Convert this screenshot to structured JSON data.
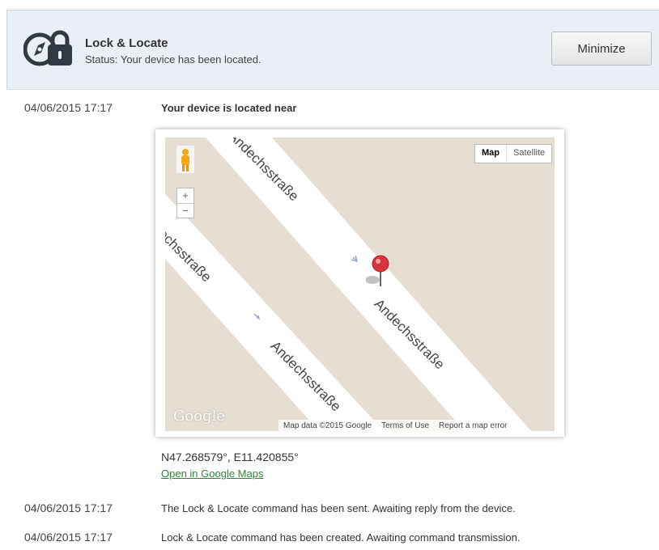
{
  "header": {
    "title": "Lock & Locate",
    "status": "Status: Your device has been located.",
    "minimize_label": "Minimize"
  },
  "log": [
    {
      "timestamp": "04/06/2015 17:17",
      "message": "Your device is located near"
    },
    {
      "timestamp": "04/06/2015 17:17",
      "message": "The Lock & Locate command has been sent. Awaiting reply from the device."
    },
    {
      "timestamp": "04/06/2015 17:17",
      "message": "Lock & Locate command has been created. Awaiting command transmission."
    }
  ],
  "map": {
    "type_map": "Map",
    "type_satellite": "Satellite",
    "zoom_in": "+",
    "zoom_out": "−",
    "street_name": "Andechsstraße",
    "street_label_1": "Andechsstraße",
    "street_label_2": "Andechsstraße",
    "street_label_3": "Andechsstraße",
    "street_label_4": "Andechsstraße",
    "logo": "Google",
    "attribution_data": "Map data ©2015 Google",
    "attribution_terms": "Terms of Use",
    "attribution_report": "Report a map error",
    "road_color": "#ffffff",
    "land_color": "#e6ded2",
    "pin_color": "#d9343a"
  },
  "location": {
    "coords": "N47.268579°, E11.420855°",
    "open_link": "Open in Google Maps"
  }
}
